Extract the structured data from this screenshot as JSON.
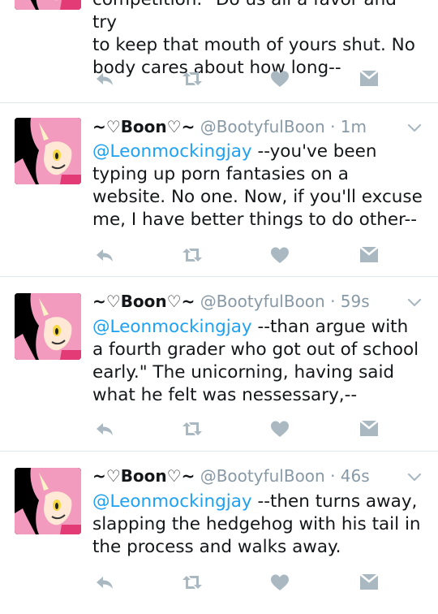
{
  "colors": {
    "mention": "#1da1f2",
    "muted": "#8899a6",
    "icon": "#aab8c2",
    "divider": "#e1e8ed"
  },
  "top_tweet": {
    "text_partial_top": "competition.\" Do us all a favor and try",
    "text_line_2": "to keep that mouth of yours shut. No",
    "text_line_3": "body cares about how long--"
  },
  "tweets": [
    {
      "display_name": "~♡Boon♡~",
      "handle": "@BootyfulBoon",
      "time": "· 1m",
      "mention": "@Leonmockingjay",
      "text": " --you've been typing up porn fantasies on a website. No one. Now, if you'll excuse me, I have better things to do other--"
    },
    {
      "display_name": "~♡Boon♡~",
      "handle": "@BootyfulBoon",
      "time": "· 59s",
      "mention": "@Leonmockingjay",
      "text": " --than argue with a fourth grader who got out of school early.\" The unicorning, having said what he felt was nessessary,--"
    },
    {
      "display_name": "~♡Boon♡~",
      "handle": "@BootyfulBoon",
      "time": "· 46s",
      "mention": "@Leonmockingjay",
      "text": " --then turns away, slapping the hedgehog with his tail in the process and walks away."
    }
  ],
  "icons": [
    "reply-icon",
    "retweet-icon",
    "like-icon",
    "direct-message-icon",
    "chevron-down-icon"
  ]
}
